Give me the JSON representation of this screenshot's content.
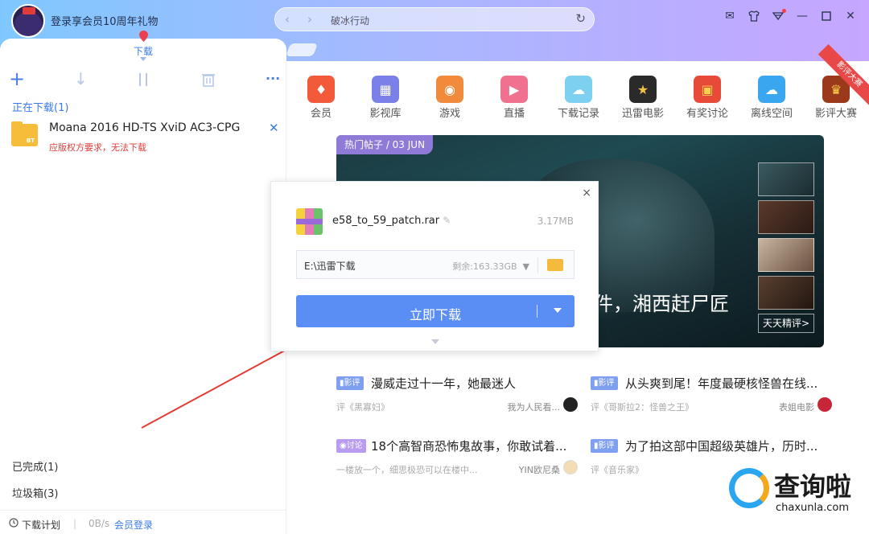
{
  "header": {
    "promo": "登录享会员10周年礼物",
    "tab_label": "下载",
    "address": "破冰行动",
    "nav_back": "‹",
    "nav_forward": "›",
    "refresh": "↻"
  },
  "window_controls": {
    "mail": "✉",
    "shirt": "👕",
    "menu": "▽",
    "min": "—",
    "max": "☐",
    "close": "✕"
  },
  "toolbar": {
    "add": "+",
    "start": "↓",
    "pause": "⏸",
    "delete": "🗑",
    "more": "···"
  },
  "downloads": {
    "section_title": "正在下载(1)",
    "items": [
      {
        "name": "Moana 2016 HD-TS XviD AC3-CPG",
        "status": "应版权方要求，无法下载",
        "badge": "BT"
      }
    ],
    "done": "已完成(1)",
    "trash": "垃圾箱(3)"
  },
  "statusbar": {
    "plan": "下载计划",
    "speed": "0B/s",
    "login": "会员登录"
  },
  "categories": [
    {
      "label": "会员",
      "color": "#f25a3a",
      "glyph": "♦"
    },
    {
      "label": "影视库",
      "color": "#7b7fe8",
      "glyph": "▦"
    },
    {
      "label": "游戏",
      "color": "#f28a3c",
      "glyph": "◉"
    },
    {
      "label": "直播",
      "color": "#f07090",
      "glyph": "▶"
    },
    {
      "label": "下载记录",
      "color": "#7dd0f0",
      "glyph": "☁"
    },
    {
      "label": "迅雷电影",
      "color": "#2a2a2a",
      "glyph": "★"
    },
    {
      "label": "有奖讨论",
      "color": "#e84a3a",
      "glyph": "▣"
    },
    {
      "label": "离线空间",
      "color": "#3aa6f0",
      "glyph": "☁"
    },
    {
      "label": "影评大赛",
      "color": "#9a3a1a",
      "glyph": "♛"
    }
  ],
  "ribbon": "影评大赛",
  "banner": {
    "tag": "热门帖子 / 03 JUN",
    "title": "件，湘西赶尸匠",
    "thumb_button": "天天精评>"
  },
  "posts": [
    {
      "tag": "影评",
      "title": "漫威走过十一年，她最迷人",
      "sub": "评《黑寡妇》",
      "author": "我为人民看..."
    },
    {
      "tag": "影评",
      "title": "从头爽到尾！年度最硬核怪兽在线...",
      "sub": "评《哥斯拉2：怪兽之王》",
      "author": "表姐电影"
    },
    {
      "tag": "讨论",
      "title": "18个高智商恐怖鬼故事，你敢试着...",
      "sub": "一楼放一个，细思极恐可以在楼中...",
      "author": "YIN欧尼桑"
    },
    {
      "tag": "影评",
      "title": "为了拍这部中国超级英雄片，历时...",
      "sub": "评《音乐家》",
      "author": ""
    }
  ],
  "dialog": {
    "close": "×",
    "filename": "e58_to_59_patch.rar",
    "size": "3.17MB",
    "path": "E:\\迅雷下载",
    "free": "剩余:163.33GB",
    "button": "立即下载"
  },
  "watermark": {
    "text": "查询啦",
    "url": "chaxunla.com"
  }
}
